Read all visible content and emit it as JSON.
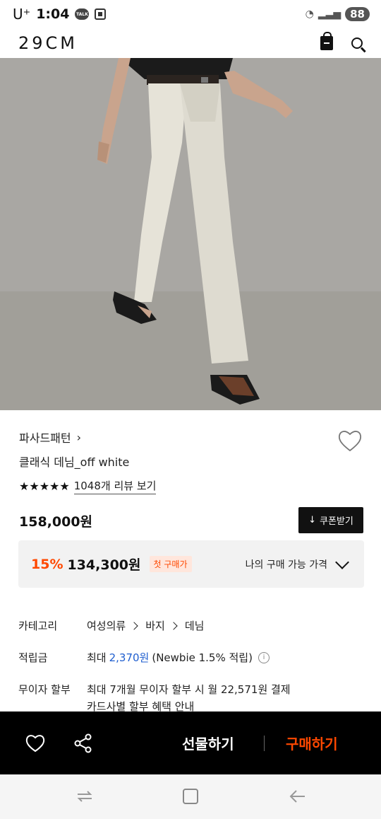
{
  "status_bar": {
    "carrier": "U⁺",
    "time": "1:04",
    "talk_label": "TALK",
    "battery": "88"
  },
  "header": {
    "logo": "29CM"
  },
  "product": {
    "brand": "파사드패턴",
    "brand_chevron": "›",
    "name": "클래식 데님_off white",
    "rating_stars": "★★★★★",
    "rating_value": 4.5,
    "review_link": "1048개 리뷰 보기",
    "price": "158,000원",
    "coupon_button": "쿠폰받기",
    "coupon_icon": "↓"
  },
  "discount": {
    "rate": "15%",
    "price": "134,300원",
    "badge": "첫 구매가",
    "my_price_label": "나의 구매 가능 가격"
  },
  "info": {
    "category_label": "카테고리",
    "category_path": [
      "여성의류",
      "바지",
      "데님"
    ],
    "points_label": "적립금",
    "points_prefix": "최대",
    "points_amount": "2,370원",
    "points_suffix": "(Newbie 1.5% 적립)",
    "installment_label": "무이자 할부",
    "installment_text": "최대 7개월 무이자 할부 시 월 22,571원 결제",
    "card_benefit_link": "카드사별 할부 혜택 안내"
  },
  "bottom_bar": {
    "gift_label": "선물하기",
    "buy_label": "구매하기"
  },
  "colors": {
    "accent": "#ff4800",
    "link_blue": "#1f5ecf",
    "bar_bg": "#000000"
  }
}
